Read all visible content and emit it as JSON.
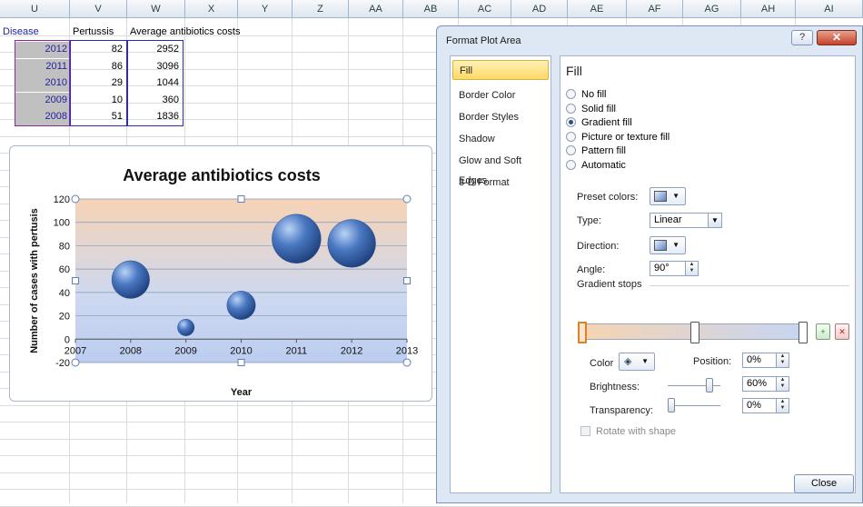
{
  "spreadsheet": {
    "columns": [
      "U",
      "V",
      "W",
      "X",
      "Y",
      "Z",
      "AA",
      "AB",
      "AC",
      "AD",
      "AE",
      "AF",
      "AG",
      "AH",
      "AI"
    ],
    "headers": [
      "Disease",
      "Pertussis",
      "Average antibiotics costs"
    ],
    "rows": [
      {
        "year": "2012",
        "pertussis": "82",
        "cost": "2952"
      },
      {
        "year": "2011",
        "pertussis": "86",
        "cost": "3096"
      },
      {
        "year": "2010",
        "pertussis": "29",
        "cost": "1044"
      },
      {
        "year": "2009",
        "pertussis": "10",
        "cost": "360"
      },
      {
        "year": "2008",
        "pertussis": "51",
        "cost": "1836"
      }
    ]
  },
  "chart": {
    "title": "Average antibiotics costs",
    "ylabel": "Number of cases with pertusis",
    "xlabel": "Year"
  },
  "chart_data": {
    "type": "scatter",
    "title": "Average antibiotics costs",
    "xlabel": "Year",
    "ylabel": "Number of cases with pertusis",
    "xlim": [
      2007,
      2013
    ],
    "ylim": [
      -20,
      120
    ],
    "x_ticks": [
      "2007",
      "2008",
      "2009",
      "2010",
      "2011",
      "2012",
      "2013"
    ],
    "y_ticks": [
      "-20",
      "0",
      "20",
      "40",
      "60",
      "80",
      "100",
      "120"
    ],
    "grid": true,
    "points": [
      {
        "x": 2008,
        "y": 51,
        "size": 1836
      },
      {
        "x": 2009,
        "y": 10,
        "size": 360
      },
      {
        "x": 2010,
        "y": 29,
        "size": 1044
      },
      {
        "x": 2011,
        "y": 86,
        "size": 3096
      },
      {
        "x": 2012,
        "y": 82,
        "size": 2952
      }
    ]
  },
  "dialog": {
    "title": "Format Plot Area",
    "help": "?",
    "close_x": "✕",
    "nav": [
      "Fill",
      "Border Color",
      "Border Styles",
      "Shadow",
      "Glow and Soft Edges",
      "3-D Format"
    ],
    "active_nav": "Fill",
    "panel_heading": "Fill",
    "fill_options": [
      "No fill",
      "Solid fill",
      "Gradient fill",
      "Picture or texture fill",
      "Pattern fill",
      "Automatic"
    ],
    "selected_fill": "Gradient fill",
    "preset_colors_label": "Preset colors:",
    "type_label": "Type:",
    "type_value": "Linear",
    "direction_label": "Direction:",
    "angle_label": "Angle:",
    "angle_value": "90°",
    "gradient_stops_label": "Gradient stops",
    "color_label": "Color",
    "position_label": "Position:",
    "position_value": "0%",
    "brightness_label": "Brightness:",
    "brightness_value": "60%",
    "transparency_label": "Transparency:",
    "transparency_value": "0%",
    "rotate_label": "Rotate with shape",
    "close_label": "Close"
  },
  "colors": {
    "bubble": "#4a78c2",
    "accent": "#ffd964"
  }
}
